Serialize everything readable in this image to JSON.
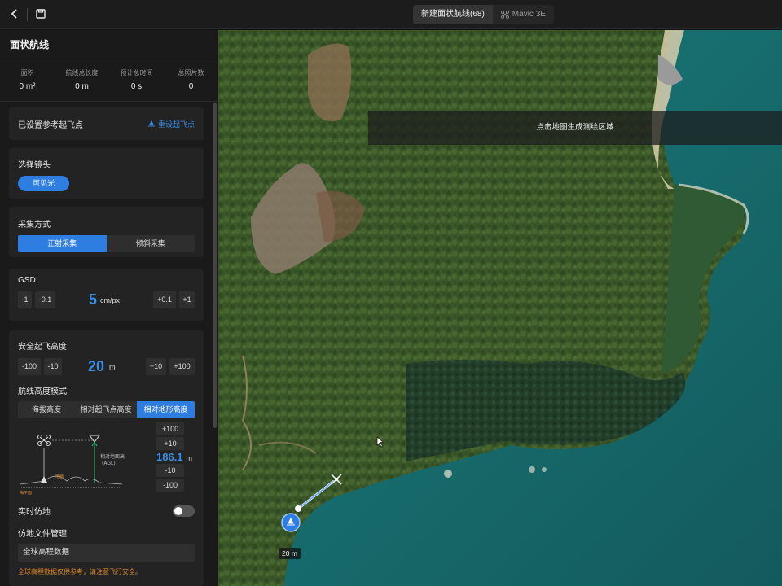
{
  "topbar": {
    "tab_route": "新建面状航线(68)",
    "tab_drone": "Mavic 3E"
  },
  "sidebar": {
    "title": "面状航线",
    "stats": [
      {
        "label": "面积",
        "value": "0 m²"
      },
      {
        "label": "航线总长度",
        "value": "0 m"
      },
      {
        "label": "预计总时间",
        "value": "0 s"
      },
      {
        "label": "总照片数",
        "value": "0"
      }
    ],
    "takeoff": {
      "status": "已设置参考起飞点",
      "reset_label": "重设起飞点"
    },
    "lens": {
      "title": "选择镜头",
      "option": "可见光"
    },
    "capture": {
      "title": "采集方式",
      "options": [
        "正射采集",
        "倾斜采集"
      ],
      "selected": "正射采集"
    },
    "gsd": {
      "title": "GSD",
      "dec_buttons": [
        "-1",
        "-0.1"
      ],
      "value": "5",
      "unit": "cm/px",
      "inc_buttons": [
        "+0.1",
        "+1"
      ]
    },
    "safe_height": {
      "title": "安全起飞高度",
      "dec_buttons": [
        "-100",
        "-10"
      ],
      "value": "20",
      "unit": "m",
      "inc_buttons": [
        "+10",
        "+100"
      ]
    },
    "altitude_mode": {
      "title": "航线高度模式",
      "options": [
        "海拔高度",
        "相对起飞点高度",
        "相对地形高度"
      ],
      "selected": "相对地形高度",
      "diagram_label_agl": "相对地面高",
      "diagram_label_agl2": "(AGL)",
      "diagram_label_ground": "地面",
      "diagram_label_sea": "海平面",
      "stepper_inc": [
        "+100",
        "+10"
      ],
      "value": "186.1",
      "unit": "m",
      "stepper_dec": [
        "-10",
        "-100"
      ]
    },
    "realtime_follow": {
      "label": "实时仿地",
      "enabled": false
    },
    "terrain_file": {
      "title": "仿地文件管理",
      "value": "全球高程数据",
      "warning": "全球高程数据仅供参考，请注意飞行安全。"
    }
  },
  "map": {
    "hint": "点击地图生成测绘区域",
    "scale": "20 m"
  },
  "colors": {
    "accent": "#2e7de0",
    "warning": "#e08a2a",
    "sea": "#1f6f6e",
    "land": "#3d5a2a"
  }
}
